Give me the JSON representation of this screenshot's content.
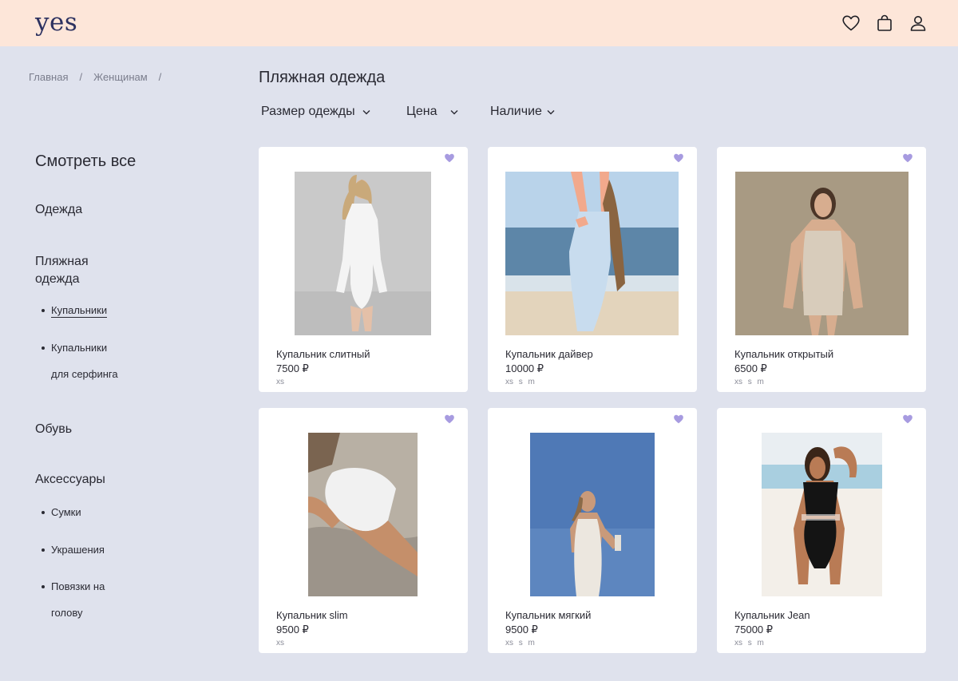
{
  "header": {
    "logo": "yes"
  },
  "breadcrumb": {
    "items": [
      "Главная",
      "Женщинам"
    ],
    "separator": "/"
  },
  "page": {
    "title": "Пляжная одежда"
  },
  "filters": [
    {
      "label": "Размер одежды"
    },
    {
      "label": "Цена"
    },
    {
      "label": "Наличие"
    }
  ],
  "sidebar": {
    "view_all": "Смотреть все",
    "clothes": "Одежда",
    "beachwear_line1": "Пляжная",
    "beachwear_line2": "одежда",
    "swimsuits": "Купальники",
    "surf_line1": "Купальники",
    "surf_line2": "для серфинга",
    "shoes": "Обувь",
    "accessories": "Аксессуары",
    "bags": "Сумки",
    "jewelry": "Украшения",
    "headbands_line1": "Повязки на",
    "headbands_line2": "голову"
  },
  "products": [
    {
      "name": "Купальник слитный",
      "price": "7500 ₽",
      "sizes": "xs"
    },
    {
      "name": "Купальник дайвер",
      "price": "10000 ₽",
      "sizes": "xs s m"
    },
    {
      "name": "Купальник открытый",
      "price": "6500 ₽",
      "sizes": "xs s m"
    },
    {
      "name": "Купальник slim",
      "price": "9500 ₽",
      "sizes": "xs"
    },
    {
      "name": "Купальник мягкий",
      "price": "9500 ₽",
      "sizes": "xs s m"
    },
    {
      "name": "Купальник Jean",
      "price": "75000 ₽",
      "sizes": "xs s m"
    }
  ],
  "colors": {
    "header_bg": "#fde6d9",
    "page_bg": "#dfe2ed",
    "logo": "#2c3160",
    "favorite": "#a79be0"
  },
  "icons": [
    "heart-icon",
    "bag-icon",
    "user-icon",
    "chevron-down-icon",
    "favorite-heart-icon"
  ]
}
